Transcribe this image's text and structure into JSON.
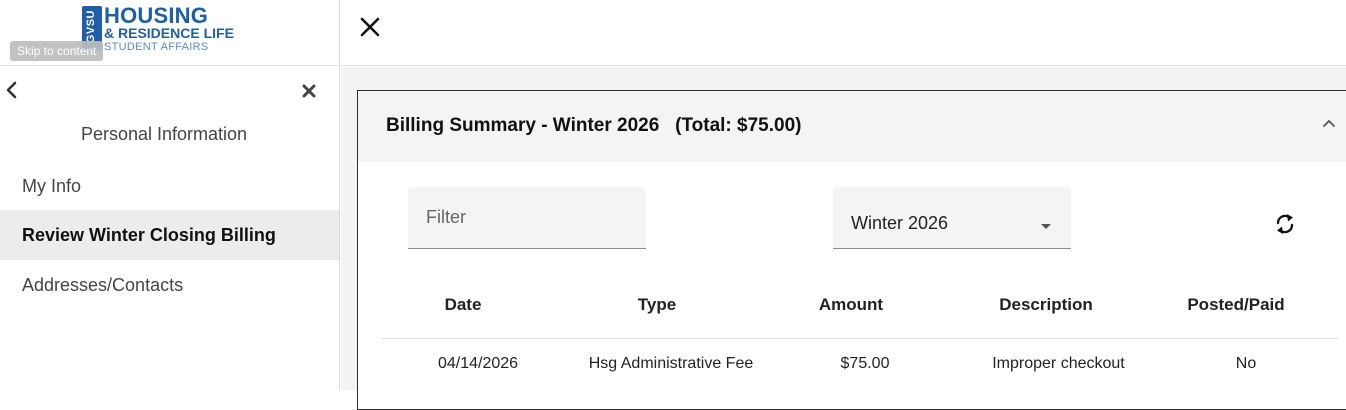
{
  "logo": {
    "mark": "GVSU",
    "line1": "HOUSING",
    "line2": "& RESIDENCE LIFE",
    "line3": "STUDENT AFFAIRS"
  },
  "skip_link": "Skip to content",
  "sidebar": {
    "heading": "Personal Information",
    "items": [
      {
        "label": "My Info",
        "active": false
      },
      {
        "label": "Review Winter Closing Billing",
        "active": true
      },
      {
        "label": "Addresses/Contacts",
        "active": false
      }
    ]
  },
  "billing": {
    "title": "Billing Summary - Winter 2026   (Total: $75.00)",
    "filter_placeholder": "Filter",
    "term_selected": "Winter 2026",
    "columns": [
      "Date",
      "Type",
      "Amount",
      "Description",
      "Posted/Paid"
    ],
    "rows": [
      [
        "04/14/2026",
        "Hsg Administrative Fee",
        "$75.00",
        "Improper checkout",
        "No"
      ]
    ]
  },
  "icons": {
    "back": "chevron-left-icon",
    "close_nav": "close-icon",
    "topbar_close": "close-icon",
    "collapse": "chevron-up-icon",
    "dropdown": "caret-down-icon",
    "refresh": "refresh-icon"
  },
  "colors": {
    "brand": "#1f5fa6",
    "active_nav_bg": "#ececec",
    "header_bg": "#f4f4f4"
  }
}
